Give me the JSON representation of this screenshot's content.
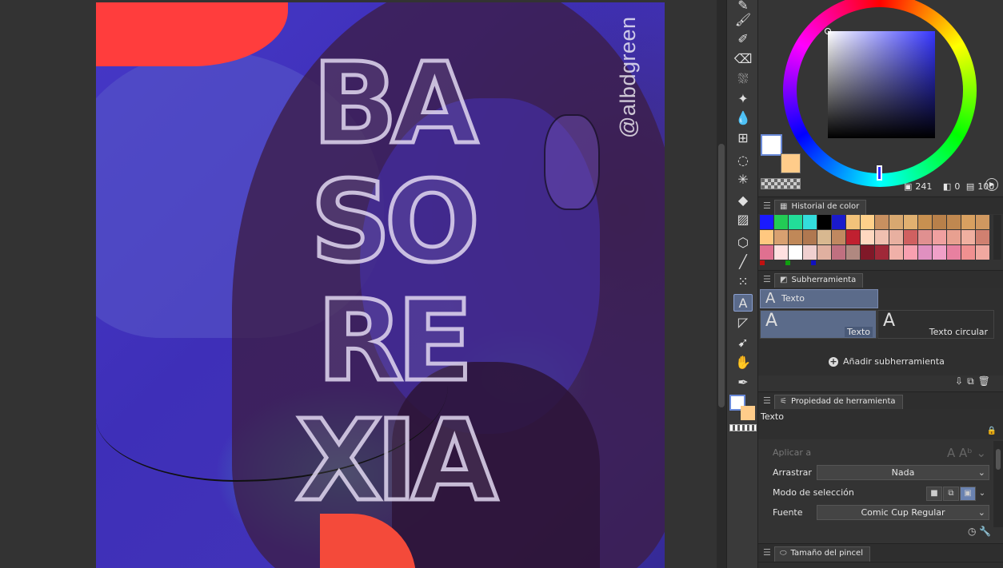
{
  "canvas": {
    "watermark": "@albdgreen",
    "title_lines": [
      "BA",
      "SO",
      "RE",
      "XIA"
    ]
  },
  "toolbar": {
    "tools": [
      {
        "name": "pen-icon",
        "glyph": "✎"
      },
      {
        "name": "brush-icon",
        "glyph": "🖌"
      },
      {
        "name": "marker-icon",
        "glyph": "✐"
      },
      {
        "name": "eraser-icon",
        "glyph": "⌫"
      },
      {
        "name": "airbrush-icon",
        "glyph": "⛆"
      },
      {
        "name": "sparkle-icon",
        "glyph": "✦"
      },
      {
        "name": "blend-icon",
        "glyph": "💧"
      },
      {
        "name": "grid-icon",
        "glyph": "⊞"
      },
      {
        "name": "lasso-icon",
        "glyph": "◌"
      },
      {
        "name": "magic-wand-icon",
        "glyph": "✳"
      },
      {
        "name": "fill-icon",
        "glyph": "◆"
      },
      {
        "name": "gradient-icon",
        "glyph": "▨"
      },
      {
        "name": "3d-icon",
        "glyph": "⬡"
      },
      {
        "name": "line-icon",
        "glyph": "╱"
      },
      {
        "name": "dots-icon",
        "glyph": "⁙"
      },
      {
        "name": "text-tool-icon",
        "glyph": "A"
      },
      {
        "name": "frame-icon",
        "glyph": "◸"
      },
      {
        "name": "object-icon",
        "glyph": "➹"
      },
      {
        "name": "hand-icon",
        "glyph": "✋"
      },
      {
        "name": "eyedropper-icon",
        "glyph": "✒"
      }
    ]
  },
  "color": {
    "main": "#ffffff",
    "sub": "#ffcc8a",
    "hue_value": "241",
    "sat_value": "0",
    "val_value": "100",
    "readout_icons": [
      "▣",
      "◧",
      "▤"
    ]
  },
  "color_history": {
    "tab_label": "Historial de color",
    "swatches": [
      "#1a1aff",
      "#22cc55",
      "#22dd99",
      "#33dddd",
      "#000000",
      "#1a1acc",
      "#f2c27a",
      "#ffd08a",
      "#c89060",
      "#d8a870",
      "#e0b070",
      "#c89050",
      "#b8804a",
      "#c08850",
      "#d8a060",
      "#d09860",
      "#ffc880",
      "#d8a070",
      "#c08858",
      "#b07850",
      "#d8b890",
      "#c08860",
      "#c02030",
      "#ffd8c0",
      "#f0c0b0",
      "#e8b0a0",
      "#d06060",
      "#e09090",
      "#f0a0a0",
      "#e8a090",
      "#f0b0a0",
      "#d08070",
      "#e07090",
      "#ffe0e0",
      "#ffffff",
      "#f0d0d0",
      "#e0b0a0",
      "#c07080",
      "#b08880",
      "#801828",
      "#a02838",
      "#f0b0a8",
      "#f8a0b0",
      "#e090c0",
      "#f0a0c8",
      "#e880a0",
      "#f09090",
      "#f0a8a0"
    ],
    "marks": [
      "#c01010",
      "#10a010",
      "#1010c0"
    ]
  },
  "subtool": {
    "tab_label": "Subherramienta",
    "group_label": "Texto",
    "tiles": [
      {
        "label": "Texto"
      },
      {
        "label": "Texto circular"
      }
    ],
    "add_label": "Añadir subherramienta",
    "action_icons": [
      "⇩",
      "⧉",
      "🗑"
    ]
  },
  "tool_property": {
    "tab_label": "Propiedad de herramienta",
    "title": "Texto",
    "aplicar_label": "Aplicar a",
    "arrastrar_label": "Arrastrar",
    "arrastrar_value": "Nada",
    "modo_label": "Modo de selección",
    "fuente_label": "Fuente",
    "fuente_value": "Comic Cup Regular",
    "footer_icons": [
      "◷",
      "🔧"
    ]
  },
  "brush_size": {
    "tab_label": "Tamaño del pincel"
  }
}
